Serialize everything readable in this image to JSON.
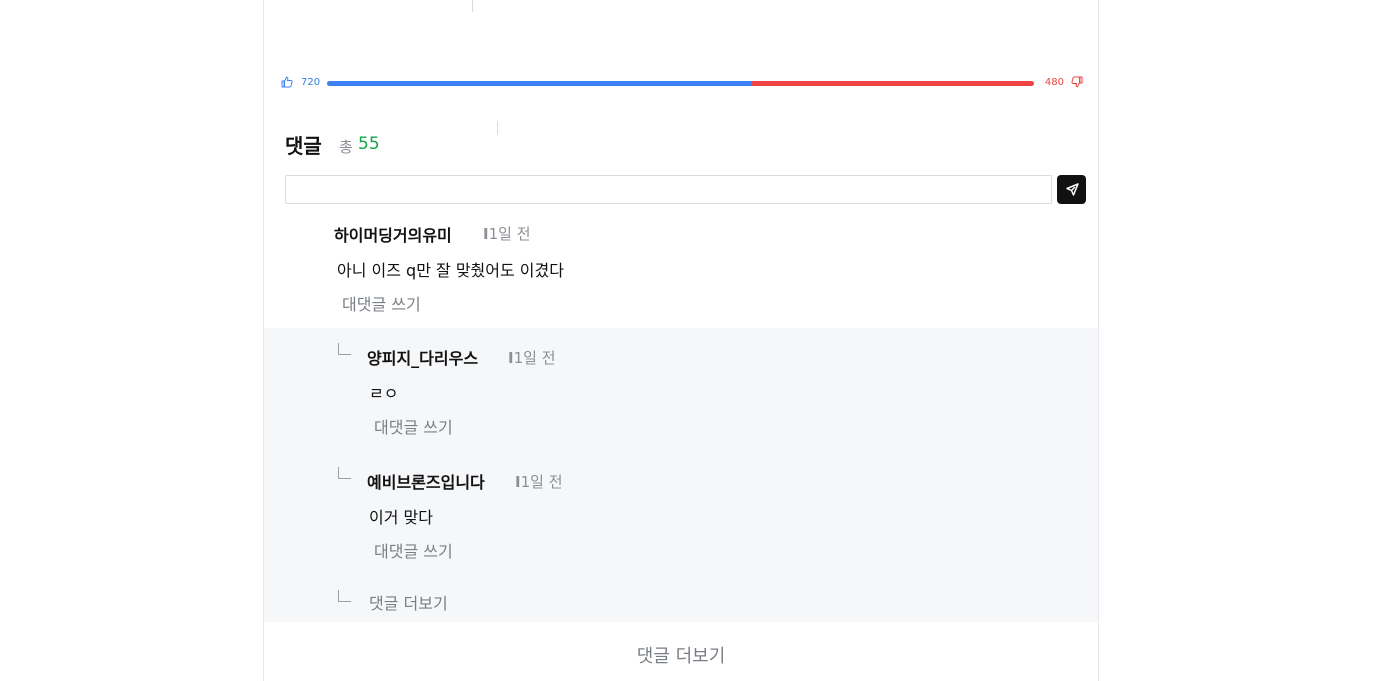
{
  "votes": {
    "up_count": "720",
    "down_count": "480",
    "up_ratio": 0.6
  },
  "comments_header": {
    "title": "댓글",
    "total_label": "총",
    "total_count": "55"
  },
  "comment_input": {
    "value": "",
    "placeholder": ""
  },
  "comment": {
    "author": "하이머딩거의유미",
    "time": "1일 전",
    "body": "아니 이즈 q만 잘 맞췄어도 이겼다",
    "reply_label": "대댓글 쓰기"
  },
  "replies": [
    {
      "author": "양피지_다리우스",
      "time": "1일 전",
      "body": "ㄹㅇ",
      "reply_label": "대댓글 쓰기"
    },
    {
      "author": "예비브론즈입니다",
      "time": "1일 전",
      "body": "이거 맞다",
      "reply_label": "대댓글 쓰기"
    }
  ],
  "more_replies_label": "댓글 더보기",
  "more_comments_label": "댓글 더보기",
  "colors": {
    "up": "#3b82f6",
    "down": "#ef4444",
    "count": "#16a34a"
  },
  "icons": {
    "up": "thumbs-up-icon",
    "down": "thumbs-down-icon",
    "send": "send-cursor-icon",
    "branch": "reply-branch-icon"
  }
}
